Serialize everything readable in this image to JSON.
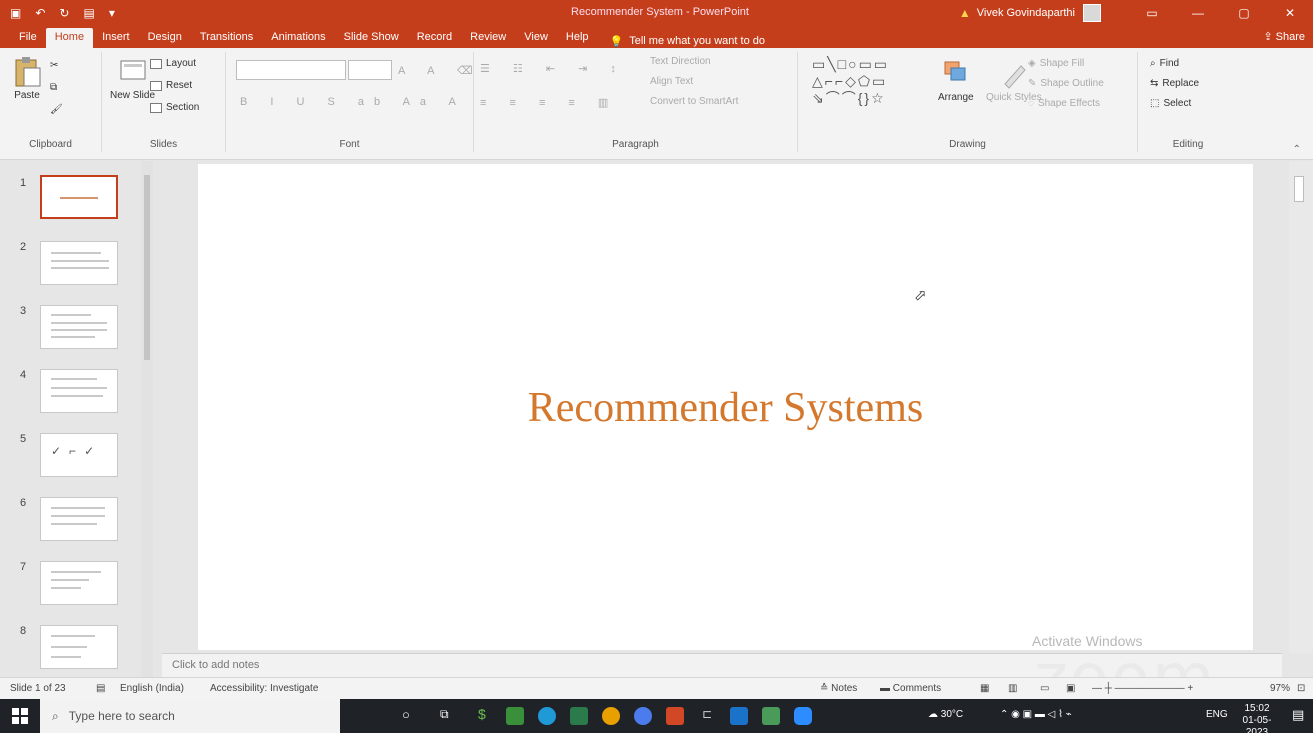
{
  "window": {
    "title": "Recommender System - PowerPoint",
    "user_name": "Vivek Govindaparthi",
    "quick_access": [
      "save-icon",
      "undo-icon",
      "redo-icon",
      "present-icon",
      "customize-icon"
    ]
  },
  "tabs": [
    "File",
    "Home",
    "Insert",
    "Design",
    "Transitions",
    "Animations",
    "Slide Show",
    "Record",
    "Review",
    "View",
    "Help"
  ],
  "active_tab": "Home",
  "tell_me": "Tell me what you want to do",
  "share_label": "Share",
  "ribbon": {
    "clipboard": {
      "paste": "Paste",
      "label": "Clipboard"
    },
    "slides": {
      "new_slide": "New Slide",
      "layout": "Layout",
      "reset": "Reset",
      "section": "Section",
      "label": "Slides"
    },
    "font": {
      "label": "Font"
    },
    "paragraph": {
      "label": "Paragraph",
      "text_direction": "Text Direction",
      "align_text": "Align Text",
      "convert_smartart": "Convert to SmartArt"
    },
    "drawing": {
      "label": "Drawing",
      "arrange": "Arrange",
      "quick_styles": "Quick Styles",
      "shape_fill": "Shape Fill",
      "shape_outline": "Shape Outline",
      "shape_effects": "Shape Effects"
    },
    "editing": {
      "label": "Editing",
      "find": "Find",
      "replace": "Replace",
      "select": "Select"
    }
  },
  "slides": [
    "1",
    "2",
    "3",
    "4",
    "5",
    "6",
    "7",
    "8"
  ],
  "current_slide": {
    "title": "Recommender Systems"
  },
  "notes_placeholder": "Click to add notes",
  "watermark": {
    "activate": "Activate Windows",
    "zoom": "zoom"
  },
  "statusbar": {
    "slide_info": "Slide 1 of 23",
    "language": "English (India)",
    "accessibility": "Accessibility: Investigate",
    "notes": "Notes",
    "comments": "Comments",
    "zoom": "97%"
  },
  "taskbar": {
    "search_placeholder": "Type here to search",
    "weather": "30°C",
    "language": "ENG",
    "time": "15:02",
    "date": "01-05-2023"
  },
  "colors": {
    "accent": "#c43e1c",
    "slide_title": "#d4782e"
  }
}
